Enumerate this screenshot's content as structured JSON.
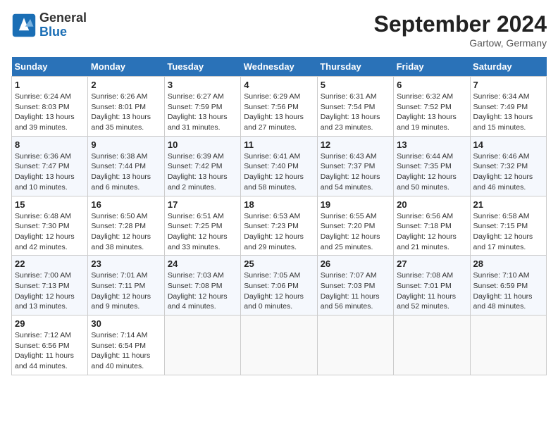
{
  "header": {
    "logo_line1": "General",
    "logo_line2": "Blue",
    "month_title": "September 2024",
    "location": "Gartow, Germany"
  },
  "weekdays": [
    "Sunday",
    "Monday",
    "Tuesday",
    "Wednesday",
    "Thursday",
    "Friday",
    "Saturday"
  ],
  "weeks": [
    [
      {
        "day": "1",
        "sunrise": "6:24 AM",
        "sunset": "8:03 PM",
        "daylight": "13 hours and 39 minutes."
      },
      {
        "day": "2",
        "sunrise": "6:26 AM",
        "sunset": "8:01 PM",
        "daylight": "13 hours and 35 minutes."
      },
      {
        "day": "3",
        "sunrise": "6:27 AM",
        "sunset": "7:59 PM",
        "daylight": "13 hours and 31 minutes."
      },
      {
        "day": "4",
        "sunrise": "6:29 AM",
        "sunset": "7:56 PM",
        "daylight": "13 hours and 27 minutes."
      },
      {
        "day": "5",
        "sunrise": "6:31 AM",
        "sunset": "7:54 PM",
        "daylight": "13 hours and 23 minutes."
      },
      {
        "day": "6",
        "sunrise": "6:32 AM",
        "sunset": "7:52 PM",
        "daylight": "13 hours and 19 minutes."
      },
      {
        "day": "7",
        "sunrise": "6:34 AM",
        "sunset": "7:49 PM",
        "daylight": "13 hours and 15 minutes."
      }
    ],
    [
      {
        "day": "8",
        "sunrise": "6:36 AM",
        "sunset": "7:47 PM",
        "daylight": "13 hours and 10 minutes."
      },
      {
        "day": "9",
        "sunrise": "6:38 AM",
        "sunset": "7:44 PM",
        "daylight": "13 hours and 6 minutes."
      },
      {
        "day": "10",
        "sunrise": "6:39 AM",
        "sunset": "7:42 PM",
        "daylight": "13 hours and 2 minutes."
      },
      {
        "day": "11",
        "sunrise": "6:41 AM",
        "sunset": "7:40 PM",
        "daylight": "12 hours and 58 minutes."
      },
      {
        "day": "12",
        "sunrise": "6:43 AM",
        "sunset": "7:37 PM",
        "daylight": "12 hours and 54 minutes."
      },
      {
        "day": "13",
        "sunrise": "6:44 AM",
        "sunset": "7:35 PM",
        "daylight": "12 hours and 50 minutes."
      },
      {
        "day": "14",
        "sunrise": "6:46 AM",
        "sunset": "7:32 PM",
        "daylight": "12 hours and 46 minutes."
      }
    ],
    [
      {
        "day": "15",
        "sunrise": "6:48 AM",
        "sunset": "7:30 PM",
        "daylight": "12 hours and 42 minutes."
      },
      {
        "day": "16",
        "sunrise": "6:50 AM",
        "sunset": "7:28 PM",
        "daylight": "12 hours and 38 minutes."
      },
      {
        "day": "17",
        "sunrise": "6:51 AM",
        "sunset": "7:25 PM",
        "daylight": "12 hours and 33 minutes."
      },
      {
        "day": "18",
        "sunrise": "6:53 AM",
        "sunset": "7:23 PM",
        "daylight": "12 hours and 29 minutes."
      },
      {
        "day": "19",
        "sunrise": "6:55 AM",
        "sunset": "7:20 PM",
        "daylight": "12 hours and 25 minutes."
      },
      {
        "day": "20",
        "sunrise": "6:56 AM",
        "sunset": "7:18 PM",
        "daylight": "12 hours and 21 minutes."
      },
      {
        "day": "21",
        "sunrise": "6:58 AM",
        "sunset": "7:15 PM",
        "daylight": "12 hours and 17 minutes."
      }
    ],
    [
      {
        "day": "22",
        "sunrise": "7:00 AM",
        "sunset": "7:13 PM",
        "daylight": "12 hours and 13 minutes."
      },
      {
        "day": "23",
        "sunrise": "7:01 AM",
        "sunset": "7:11 PM",
        "daylight": "12 hours and 9 minutes."
      },
      {
        "day": "24",
        "sunrise": "7:03 AM",
        "sunset": "7:08 PM",
        "daylight": "12 hours and 4 minutes."
      },
      {
        "day": "25",
        "sunrise": "7:05 AM",
        "sunset": "7:06 PM",
        "daylight": "12 hours and 0 minutes."
      },
      {
        "day": "26",
        "sunrise": "7:07 AM",
        "sunset": "7:03 PM",
        "daylight": "11 hours and 56 minutes."
      },
      {
        "day": "27",
        "sunrise": "7:08 AM",
        "sunset": "7:01 PM",
        "daylight": "11 hours and 52 minutes."
      },
      {
        "day": "28",
        "sunrise": "7:10 AM",
        "sunset": "6:59 PM",
        "daylight": "11 hours and 48 minutes."
      }
    ],
    [
      {
        "day": "29",
        "sunrise": "7:12 AM",
        "sunset": "6:56 PM",
        "daylight": "11 hours and 44 minutes."
      },
      {
        "day": "30",
        "sunrise": "7:14 AM",
        "sunset": "6:54 PM",
        "daylight": "11 hours and 40 minutes."
      },
      null,
      null,
      null,
      null,
      null
    ]
  ]
}
